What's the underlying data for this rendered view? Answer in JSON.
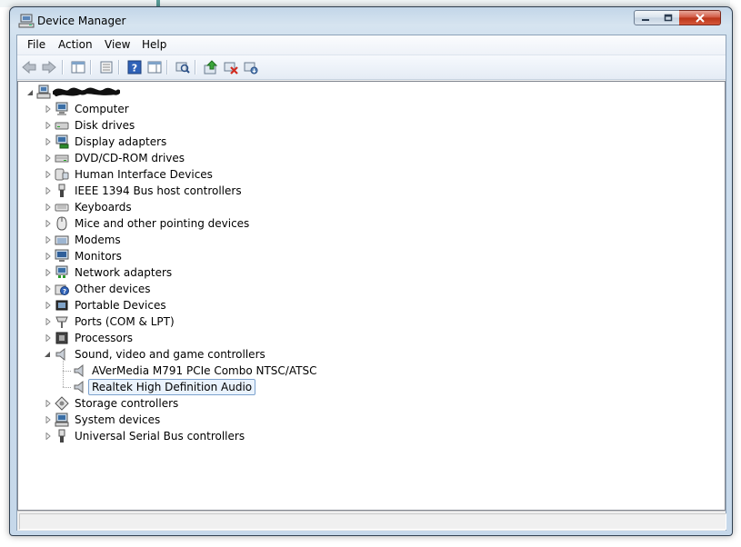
{
  "window": {
    "title": "Device Manager"
  },
  "menu": {
    "items": [
      "File",
      "Action",
      "View",
      "Help"
    ]
  },
  "toolbar": {
    "buttons": [
      "back-arrow-icon",
      "forward-arrow-icon",
      "show-hide-console-tree-icon",
      "properties-icon",
      "help-icon",
      "action-pane-icon",
      "scan-hardware-icon",
      "update-driver-icon",
      "disable-device-icon",
      "uninstall-device-icon"
    ]
  },
  "tree": {
    "root": {
      "label": "",
      "icon": "computer-root-icon",
      "expanded": true
    },
    "categories": [
      {
        "label": "Computer",
        "icon": "computer-icon",
        "expanded": false
      },
      {
        "label": "Disk drives",
        "icon": "disk-drive-icon",
        "expanded": false
      },
      {
        "label": "Display adapters",
        "icon": "display-adapter-icon",
        "expanded": false
      },
      {
        "label": "DVD/CD-ROM drives",
        "icon": "dvd-drive-icon",
        "expanded": false
      },
      {
        "label": "Human Interface Devices",
        "icon": "hid-icon",
        "expanded": false
      },
      {
        "label": "IEEE 1394 Bus host controllers",
        "icon": "ieee1394-icon",
        "expanded": false
      },
      {
        "label": "Keyboards",
        "icon": "keyboard-icon",
        "expanded": false
      },
      {
        "label": "Mice and other pointing devices",
        "icon": "mouse-icon",
        "expanded": false
      },
      {
        "label": "Modems",
        "icon": "modem-icon",
        "expanded": false
      },
      {
        "label": "Monitors",
        "icon": "monitor-icon",
        "expanded": false
      },
      {
        "label": "Network adapters",
        "icon": "network-adapter-icon",
        "expanded": false
      },
      {
        "label": "Other devices",
        "icon": "unknown-device-icon",
        "expanded": false
      },
      {
        "label": "Portable Devices",
        "icon": "portable-device-icon",
        "expanded": false
      },
      {
        "label": "Ports (COM & LPT)",
        "icon": "port-icon",
        "expanded": false
      },
      {
        "label": "Processors",
        "icon": "processor-icon",
        "expanded": false
      },
      {
        "label": "Sound, video and game controllers",
        "icon": "speaker-icon",
        "expanded": true,
        "children": [
          {
            "label": "AVerMedia M791 PCIe Combo NTSC/ATSC",
            "icon": "speaker-icon",
            "selected": false
          },
          {
            "label": "Realtek High Definition Audio",
            "icon": "speaker-icon",
            "selected": true
          }
        ]
      },
      {
        "label": "Storage controllers",
        "icon": "storage-controller-icon",
        "expanded": false
      },
      {
        "label": "System devices",
        "icon": "system-device-icon",
        "expanded": false
      },
      {
        "label": "Universal Serial Bus controllers",
        "icon": "usb-icon",
        "expanded": false
      }
    ]
  },
  "colors": {
    "selection_border": "#7da2ce",
    "selection_fill": "#eaf3fd",
    "accent": "#3a6ea5"
  }
}
